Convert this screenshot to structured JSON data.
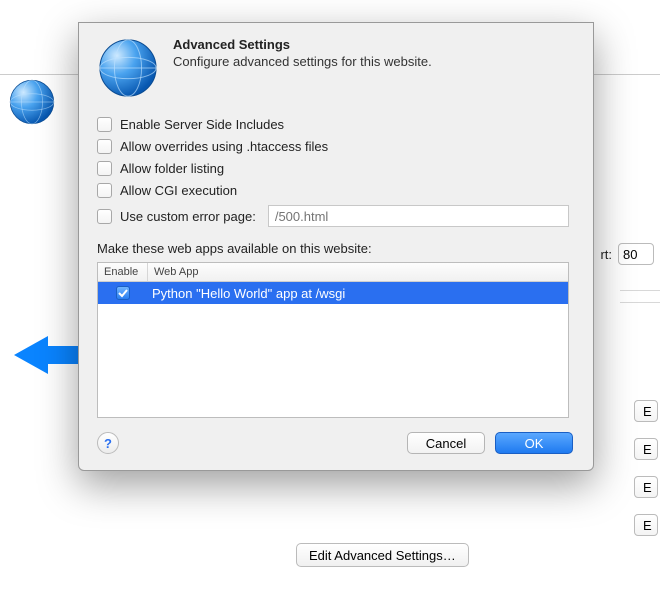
{
  "dialog": {
    "title": "Advanced Settings",
    "subtitle": "Configure advanced settings for this website."
  },
  "options": {
    "ssi": "Enable Server Side Includes",
    "htaccess": "Allow overrides using .htaccess files",
    "folder": "Allow folder listing",
    "cgi": "Allow CGI execution",
    "error_page": "Use custom error page:",
    "error_placeholder": "/500.html"
  },
  "webapps": {
    "section_label": "Make these web apps available on this website:",
    "col_enable": "Enable",
    "col_app": "Web App",
    "rows": [
      {
        "enabled": true,
        "name": "Python \"Hello World\" app at /wsgi"
      }
    ]
  },
  "footer": {
    "help": "?",
    "cancel": "Cancel",
    "ok": "OK"
  },
  "background": {
    "port_label": "rt:",
    "port_value": "80",
    "edit_button_1": "E",
    "edit_button_2": "E",
    "edit_button_3": "E",
    "edit_button_4": "E",
    "edit_advanced": "Edit Advanced Settings…"
  }
}
